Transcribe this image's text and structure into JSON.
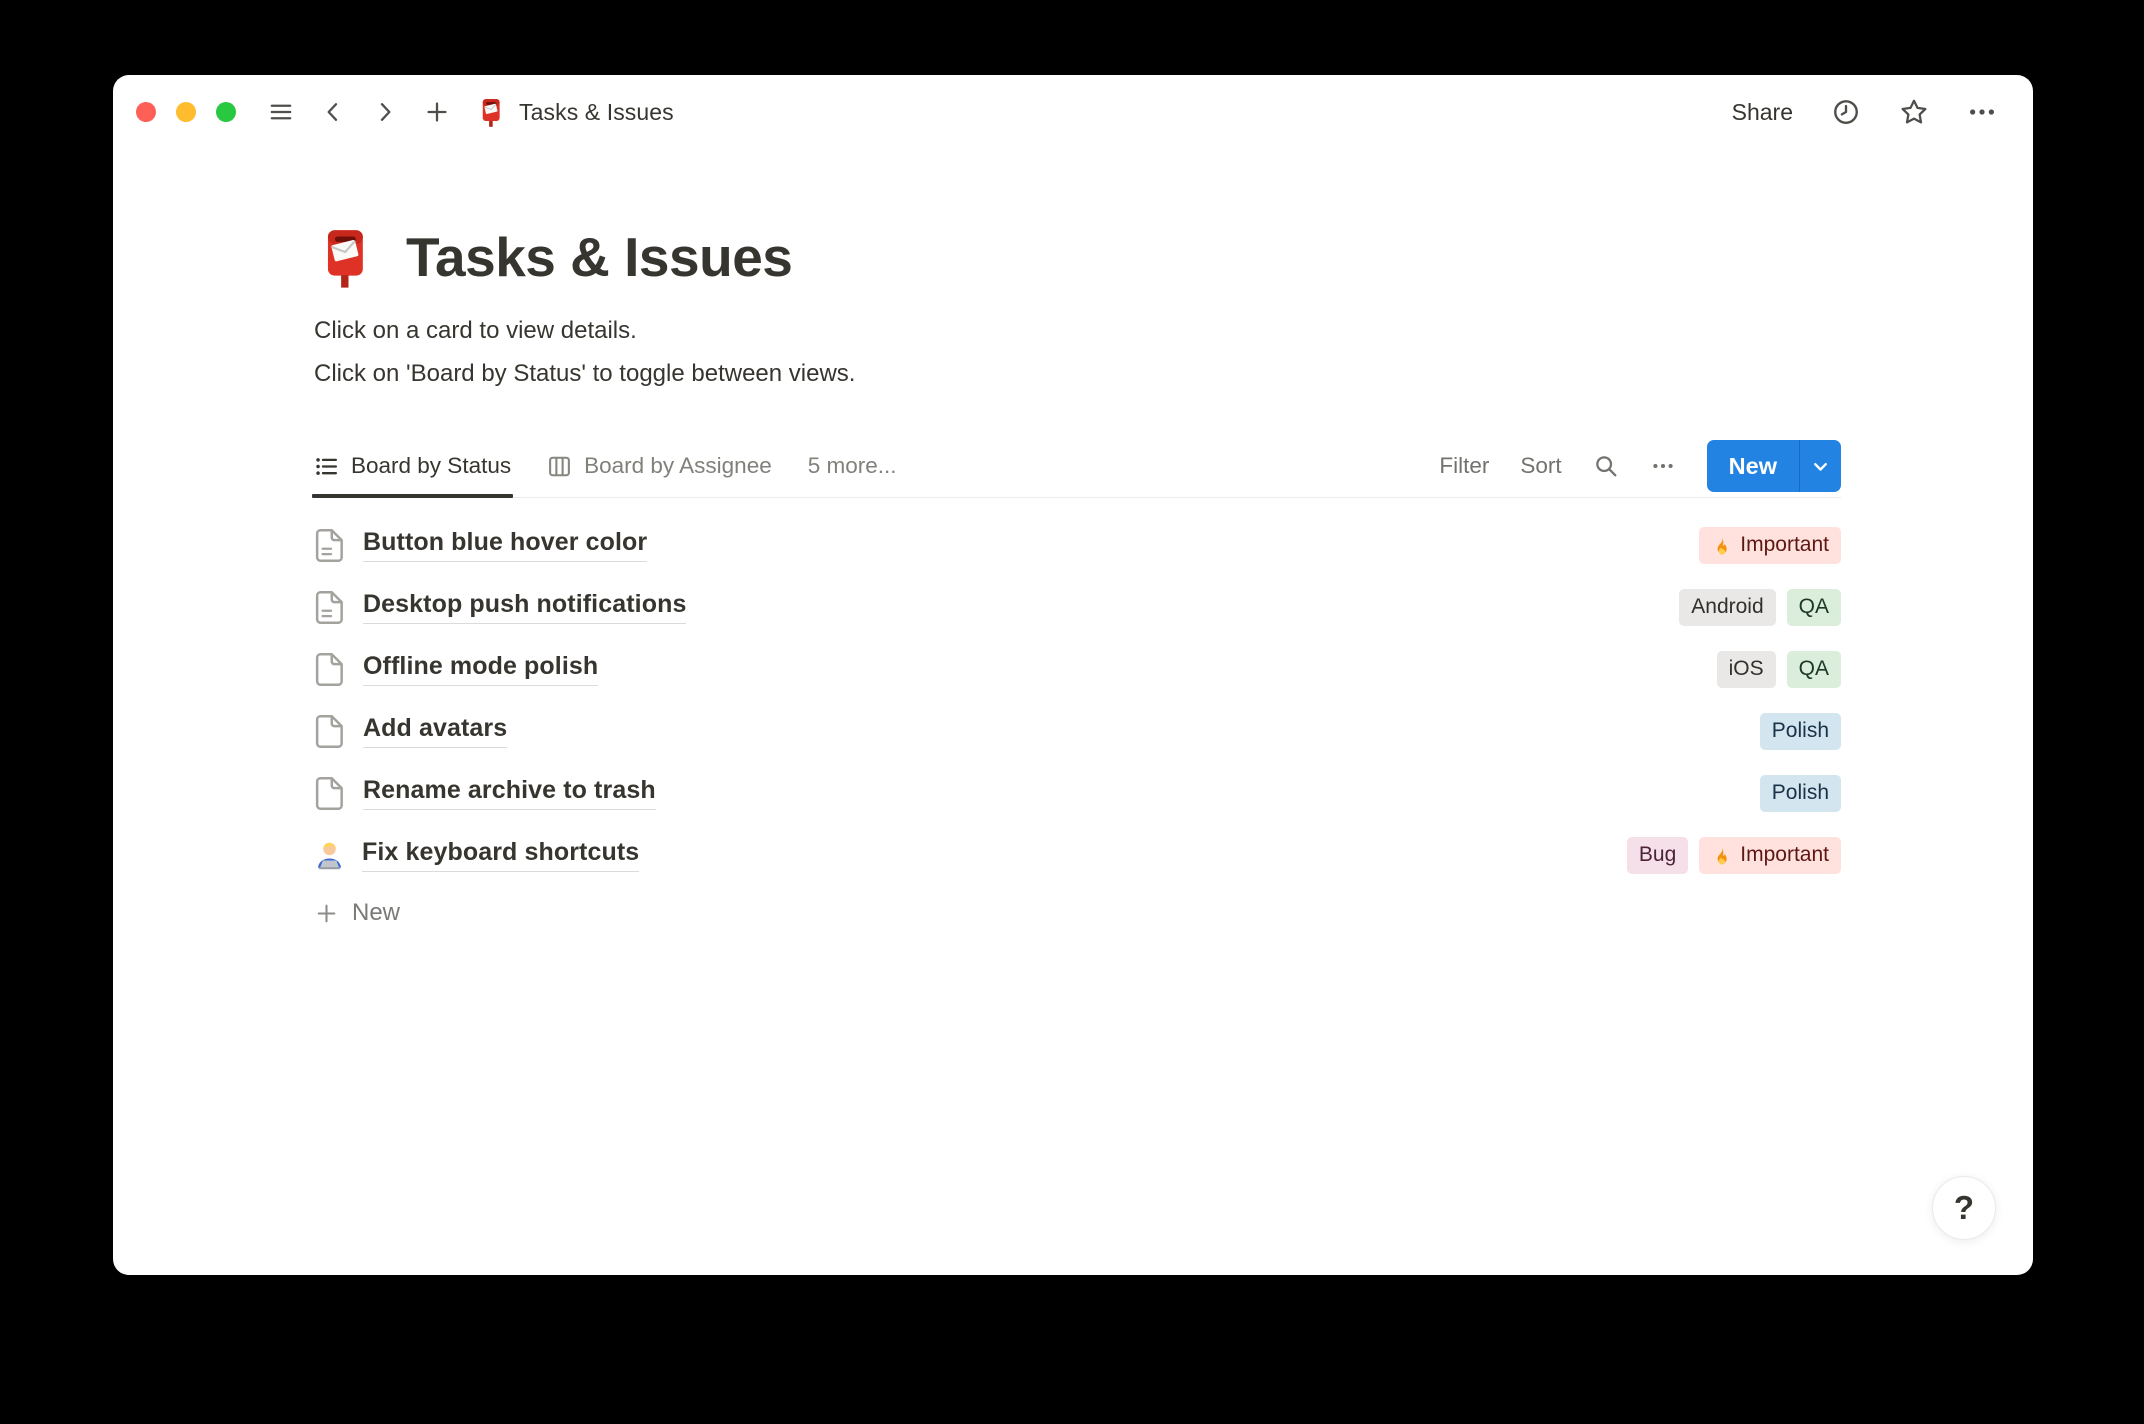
{
  "titlebar": {
    "doc_icon": "postbox-icon",
    "doc_emoji": "📮",
    "title": "Tasks & Issues",
    "share_label": "Share"
  },
  "page": {
    "emoji_icon": "postbox-icon",
    "emoji_char": "📮",
    "title": "Tasks & Issues",
    "description_line1": "Click on a card to view details.",
    "description_line2": "Click on 'Board by Status' to toggle between views."
  },
  "views": {
    "tabs": [
      {
        "label": "Board by Status",
        "icon": "list-view-icon",
        "active": true
      },
      {
        "label": "Board by Assignee",
        "icon": "board-view-icon",
        "active": false
      },
      {
        "label": "5 more...",
        "icon": null,
        "active": false
      }
    ],
    "filter_label": "Filter",
    "sort_label": "Sort",
    "new_button_label": "New"
  },
  "rows": [
    {
      "icon": "page-text-icon",
      "title": "Button blue hover color",
      "tags": [
        {
          "icon": "fire-icon",
          "emoji": "🔥",
          "label": "Important",
          "color": "red"
        }
      ]
    },
    {
      "icon": "page-text-icon",
      "title": "Desktop push notifications",
      "tags": [
        {
          "label": "Android",
          "color": "gray"
        },
        {
          "label": "QA",
          "color": "green"
        }
      ]
    },
    {
      "icon": "page-blank-icon",
      "title": "Offline mode polish",
      "tags": [
        {
          "label": "iOS",
          "color": "gray"
        },
        {
          "label": "QA",
          "color": "green"
        }
      ]
    },
    {
      "icon": "page-blank-icon",
      "title": "Add avatars",
      "tags": [
        {
          "label": "Polish",
          "color": "blue"
        }
      ]
    },
    {
      "icon": "page-blank-icon",
      "title": "Rename archive to trash",
      "tags": [
        {
          "label": "Polish",
          "color": "blue"
        }
      ]
    },
    {
      "icon": "technologist-icon",
      "emoji_icon": true,
      "emoji_char": "🧑‍💻",
      "title": "Fix keyboard shortcuts",
      "tags": [
        {
          "label": "Bug",
          "color": "pink"
        },
        {
          "icon": "fire-icon",
          "emoji": "🔥",
          "label": "Important",
          "color": "red"
        }
      ]
    }
  ],
  "new_row_label": "New",
  "help_button_label": "?",
  "colors": {
    "accent_blue": "#2383E2",
    "traffic_red": "#FF5F57",
    "traffic_yellow": "#FEBC2E",
    "traffic_green": "#28C840",
    "tag_styles": {
      "red": {
        "bg": "#FFE2DD",
        "text": "#5D1715"
      },
      "gray": {
        "bg": "#E9E8E6",
        "text": "#32302C"
      },
      "green": {
        "bg": "#DBEDDB",
        "text": "#1C3829"
      },
      "blue": {
        "bg": "#D3E5EF",
        "text": "#183347"
      },
      "pink": {
        "bg": "#F5E0E9",
        "text": "#4C2337"
      }
    }
  }
}
